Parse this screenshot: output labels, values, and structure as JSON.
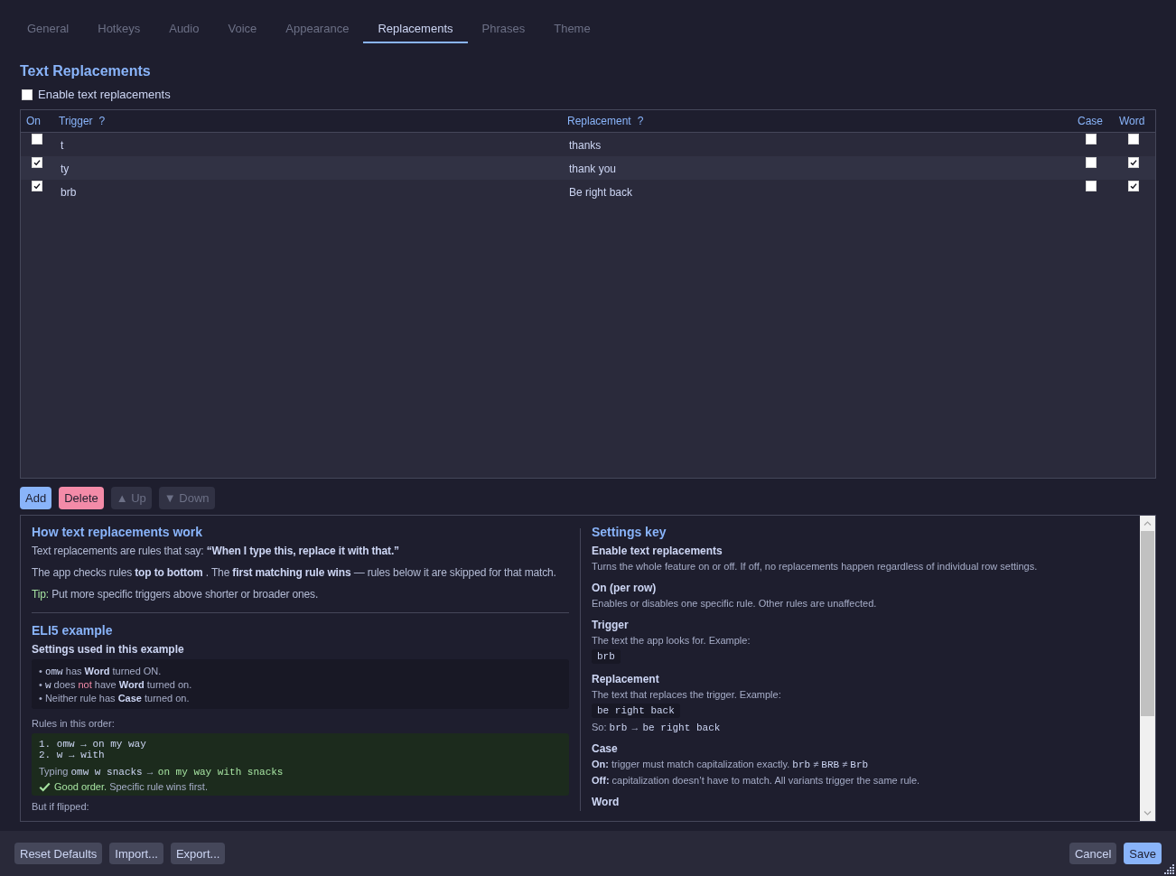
{
  "tabs": [
    {
      "label": "General",
      "selected": false
    },
    {
      "label": "Hotkeys",
      "selected": false
    },
    {
      "label": "Audio",
      "selected": false
    },
    {
      "label": "Voice",
      "selected": false
    },
    {
      "label": "Appearance",
      "selected": false
    },
    {
      "label": "Replacements",
      "selected": true
    },
    {
      "label": "Phrases",
      "selected": false
    },
    {
      "label": "Theme",
      "selected": false
    }
  ],
  "section": {
    "title": "Text Replacements",
    "enable": {
      "label": "Enable text replacements",
      "checked": false
    }
  },
  "table": {
    "columns": [
      {
        "label": "On"
      },
      {
        "label": "Trigger",
        "help": "?"
      },
      {
        "label": "Replacement",
        "help": "?"
      },
      {
        "label": "Case"
      },
      {
        "label": "Word"
      }
    ],
    "rows": [
      {
        "on": false,
        "trigger": "t",
        "replacement": "thanks",
        "case": false,
        "word": false
      },
      {
        "on": true,
        "trigger": "ty",
        "replacement": "thank you",
        "case": false,
        "word": true
      },
      {
        "on": true,
        "trigger": "brb",
        "replacement": "Be right back",
        "case": false,
        "word": true
      }
    ]
  },
  "row_actions": [
    {
      "label": "Add",
      "kind": "primary",
      "disabled": false
    },
    {
      "label": "Delete",
      "kind": "danger",
      "disabled": false
    },
    {
      "label": "▲ Up",
      "kind": "plain",
      "disabled": true
    },
    {
      "label": "▼ Down",
      "kind": "plain",
      "disabled": true
    }
  ],
  "help": {
    "left": [
      {
        "kind": "heading",
        "text": "How text replacements work"
      },
      {
        "kind": "para",
        "text": "Text replacements are rules that say: **“When I type this, replace it with that.”**"
      },
      {
        "kind": "para",
        "text": "The app checks rules **top to bottom** . The **first matching rule wins** — rules below it are skipped for that match."
      },
      {
        "kind": "para",
        "segments": [
          {
            "kind": "ok",
            "text": "Tip:"
          },
          {
            "kind": "text",
            "text": " Put more specific triggers above shorter or broader ones."
          }
        ]
      },
      {
        "kind": "divider"
      },
      {
        "kind": "heading",
        "text": "ELI5 example"
      },
      {
        "kind": "subheading",
        "text": "Settings used in this example"
      },
      {
        "kind": "bullets",
        "items": [
          {
            "bullet": "•",
            "segments": [
              {
                "kind": "code",
                "text": "omw"
              },
              {
                "kind": "text",
                "text": " has **Word** turned ON."
              }
            ]
          },
          {
            "bullet": "•",
            "segments": [
              {
                "kind": "code",
                "text": "w"
              },
              {
                "kind": "text",
                "text": " does "
              },
              {
                "kind": "alert",
                "text": "not"
              },
              {
                "kind": "text",
                "text": " have **Word** turned on."
              }
            ]
          },
          {
            "bullet": "•",
            "segments": [
              {
                "kind": "text",
                "text": "Neither rule has **Case** turned on."
              }
            ]
          }
        ]
      },
      {
        "kind": "caption",
        "text": "Rules in this order:"
      },
      {
        "kind": "example",
        "code_lines": [
          "1. omw → on my way",
          "2. w → with"
        ],
        "lines": [
          [
            {
              "kind": "text",
              "text": "Typing "
            },
            {
              "kind": "code",
              "text": "omw w snacks"
            },
            {
              "kind": "text",
              "text": " → "
            },
            {
              "kind": "code_ok",
              "text": "on my way with snacks"
            }
          ],
          [
            {
              "kind": "check_icon"
            },
            {
              "kind": "ok",
              "text": "Good order."
            },
            {
              "kind": "text",
              "text": " Specific rule wins first."
            }
          ]
        ]
      },
      {
        "kind": "caption",
        "text": "But if flipped:"
      }
    ],
    "right": [
      {
        "kind": "heading",
        "text": "Settings key"
      },
      {
        "kind": "term",
        "text": "Enable text replacements"
      },
      {
        "kind": "desc",
        "text": "Turns the whole feature on or off. If off, no replacements happen regardless of individual row settings."
      },
      {
        "kind": "term",
        "text": "On (per row)"
      },
      {
        "kind": "desc",
        "text": "Enables or disables one specific rule. Other rules are unaffected."
      },
      {
        "kind": "term",
        "text": "Trigger"
      },
      {
        "kind": "desc",
        "text": "The text the app looks for. Example:"
      },
      {
        "kind": "code_box",
        "text": "brb"
      },
      {
        "kind": "term",
        "text": "Replacement"
      },
      {
        "kind": "desc",
        "text": "The text that replaces the trigger. Example:"
      },
      {
        "kind": "code_box",
        "text": "be right back"
      },
      {
        "kind": "desc",
        "segments": [
          {
            "kind": "text",
            "text": "So: "
          },
          {
            "kind": "code",
            "text": "brb"
          },
          {
            "kind": "text",
            "text": " → "
          },
          {
            "kind": "code",
            "text": "be right back"
          }
        ]
      },
      {
        "kind": "term",
        "text": "Case"
      },
      {
        "kind": "desc",
        "segments": [
          {
            "kind": "text",
            "text": "**On:** trigger must match capitalization exactly. "
          },
          {
            "kind": "code",
            "text": "brb"
          },
          {
            "kind": "text",
            "text": " ≠ "
          },
          {
            "kind": "code",
            "text": "BRB"
          },
          {
            "kind": "text",
            "text": " ≠ "
          },
          {
            "kind": "code",
            "text": "Brb"
          }
        ]
      },
      {
        "kind": "desc",
        "text": "**Off:** capitalization doesn’t have to match. All variants trigger the same rule."
      },
      {
        "kind": "term",
        "text": "Word"
      }
    ]
  },
  "footer": {
    "left_buttons": [
      {
        "label": "Reset Defaults",
        "kind": "plain"
      },
      {
        "label": "Import...",
        "kind": "plain"
      },
      {
        "label": "Export...",
        "kind": "plain"
      }
    ],
    "right_buttons": [
      {
        "label": "Cancel",
        "kind": "plain"
      },
      {
        "label": "Save",
        "kind": "primary"
      }
    ]
  }
}
